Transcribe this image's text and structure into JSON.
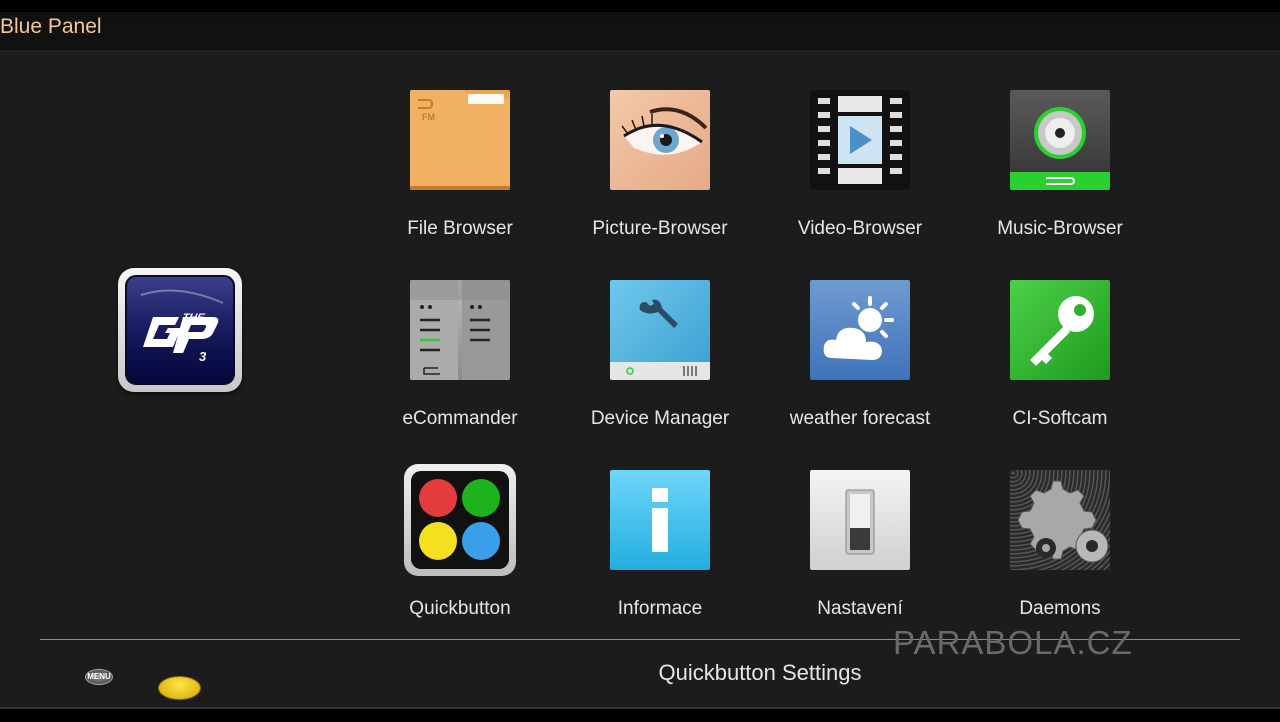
{
  "header": {
    "title": "Blue Panel"
  },
  "logo": {
    "name": "The GP3 logo"
  },
  "apps": [
    {
      "label": "File Browser",
      "icon": "folder-icon"
    },
    {
      "label": "Picture-Browser",
      "icon": "eye-icon"
    },
    {
      "label": "Video-Browser",
      "icon": "film-icon"
    },
    {
      "label": "Music-Browser",
      "icon": "speaker-icon"
    },
    {
      "label": "eCommander",
      "icon": "dual-pane-icon"
    },
    {
      "label": "Device Manager",
      "icon": "wrench-icon"
    },
    {
      "label": "weather forecast",
      "icon": "weather-icon"
    },
    {
      "label": "CI-Softcam",
      "icon": "key-icon"
    },
    {
      "label": "Quickbutton",
      "icon": "color-buttons-icon"
    },
    {
      "label": "Informace",
      "icon": "info-icon"
    },
    {
      "label": "Nastavení",
      "icon": "switch-icon"
    },
    {
      "label": "Daemons",
      "icon": "gear-icon"
    }
  ],
  "footer": {
    "menu_label": "MENU",
    "action_label": "Quickbutton Settings",
    "watermark": "PARABOLA.CZ"
  },
  "colors": {
    "title": "#f2c894",
    "background": "#1c1c1c",
    "yellow_button": "#f0c800"
  }
}
